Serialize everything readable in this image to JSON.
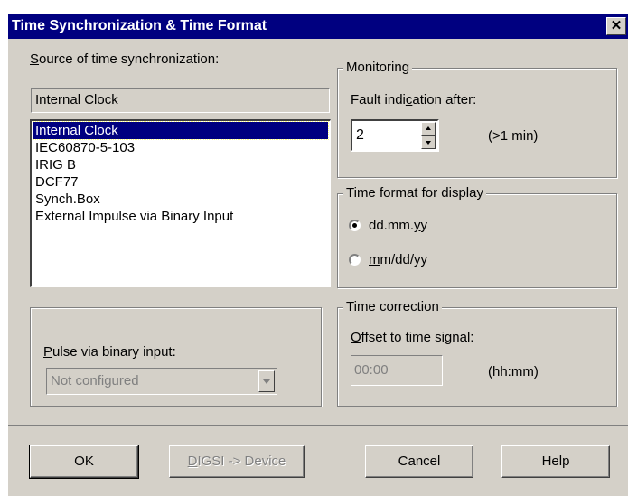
{
  "window": {
    "title": "Time Synchronization & Time Format",
    "close_glyph": "✕"
  },
  "source": {
    "label_ul": "S",
    "label_rest": "ource of time synchronization:",
    "current_value": "Internal Clock",
    "options": [
      "Internal Clock",
      "IEC60870-5-103",
      "IRIG B",
      "DCF77",
      "Synch.Box",
      "External Impulse via Binary Input"
    ],
    "selected_index": 0
  },
  "pulse": {
    "label_ul": "P",
    "label_rest": "ulse via binary input:",
    "value": "Not configured"
  },
  "monitoring": {
    "title": "Monitoring",
    "fault_label_pre": "Fault indi",
    "fault_label_ul": "c",
    "fault_label_post": "ation after:",
    "value": "2",
    "unit": "(>1 min)"
  },
  "time_format": {
    "title": "Time format for display",
    "option1_pre": "dd.mm.",
    "option1_ul": "y",
    "option1_post": "y",
    "option2_ul": "m",
    "option2_post": "m/dd/yy",
    "selected": "option1"
  },
  "time_correction": {
    "title": "Time correction",
    "offset_label_ul": "O",
    "offset_label_rest": "ffset to time signal:",
    "offset_value": "00:00",
    "unit": "(hh:mm)"
  },
  "buttons": {
    "ok": "OK",
    "digsi_ul": "D",
    "digsi_rest": "IGSI -> Device",
    "cancel": "Cancel",
    "help": "Help"
  }
}
